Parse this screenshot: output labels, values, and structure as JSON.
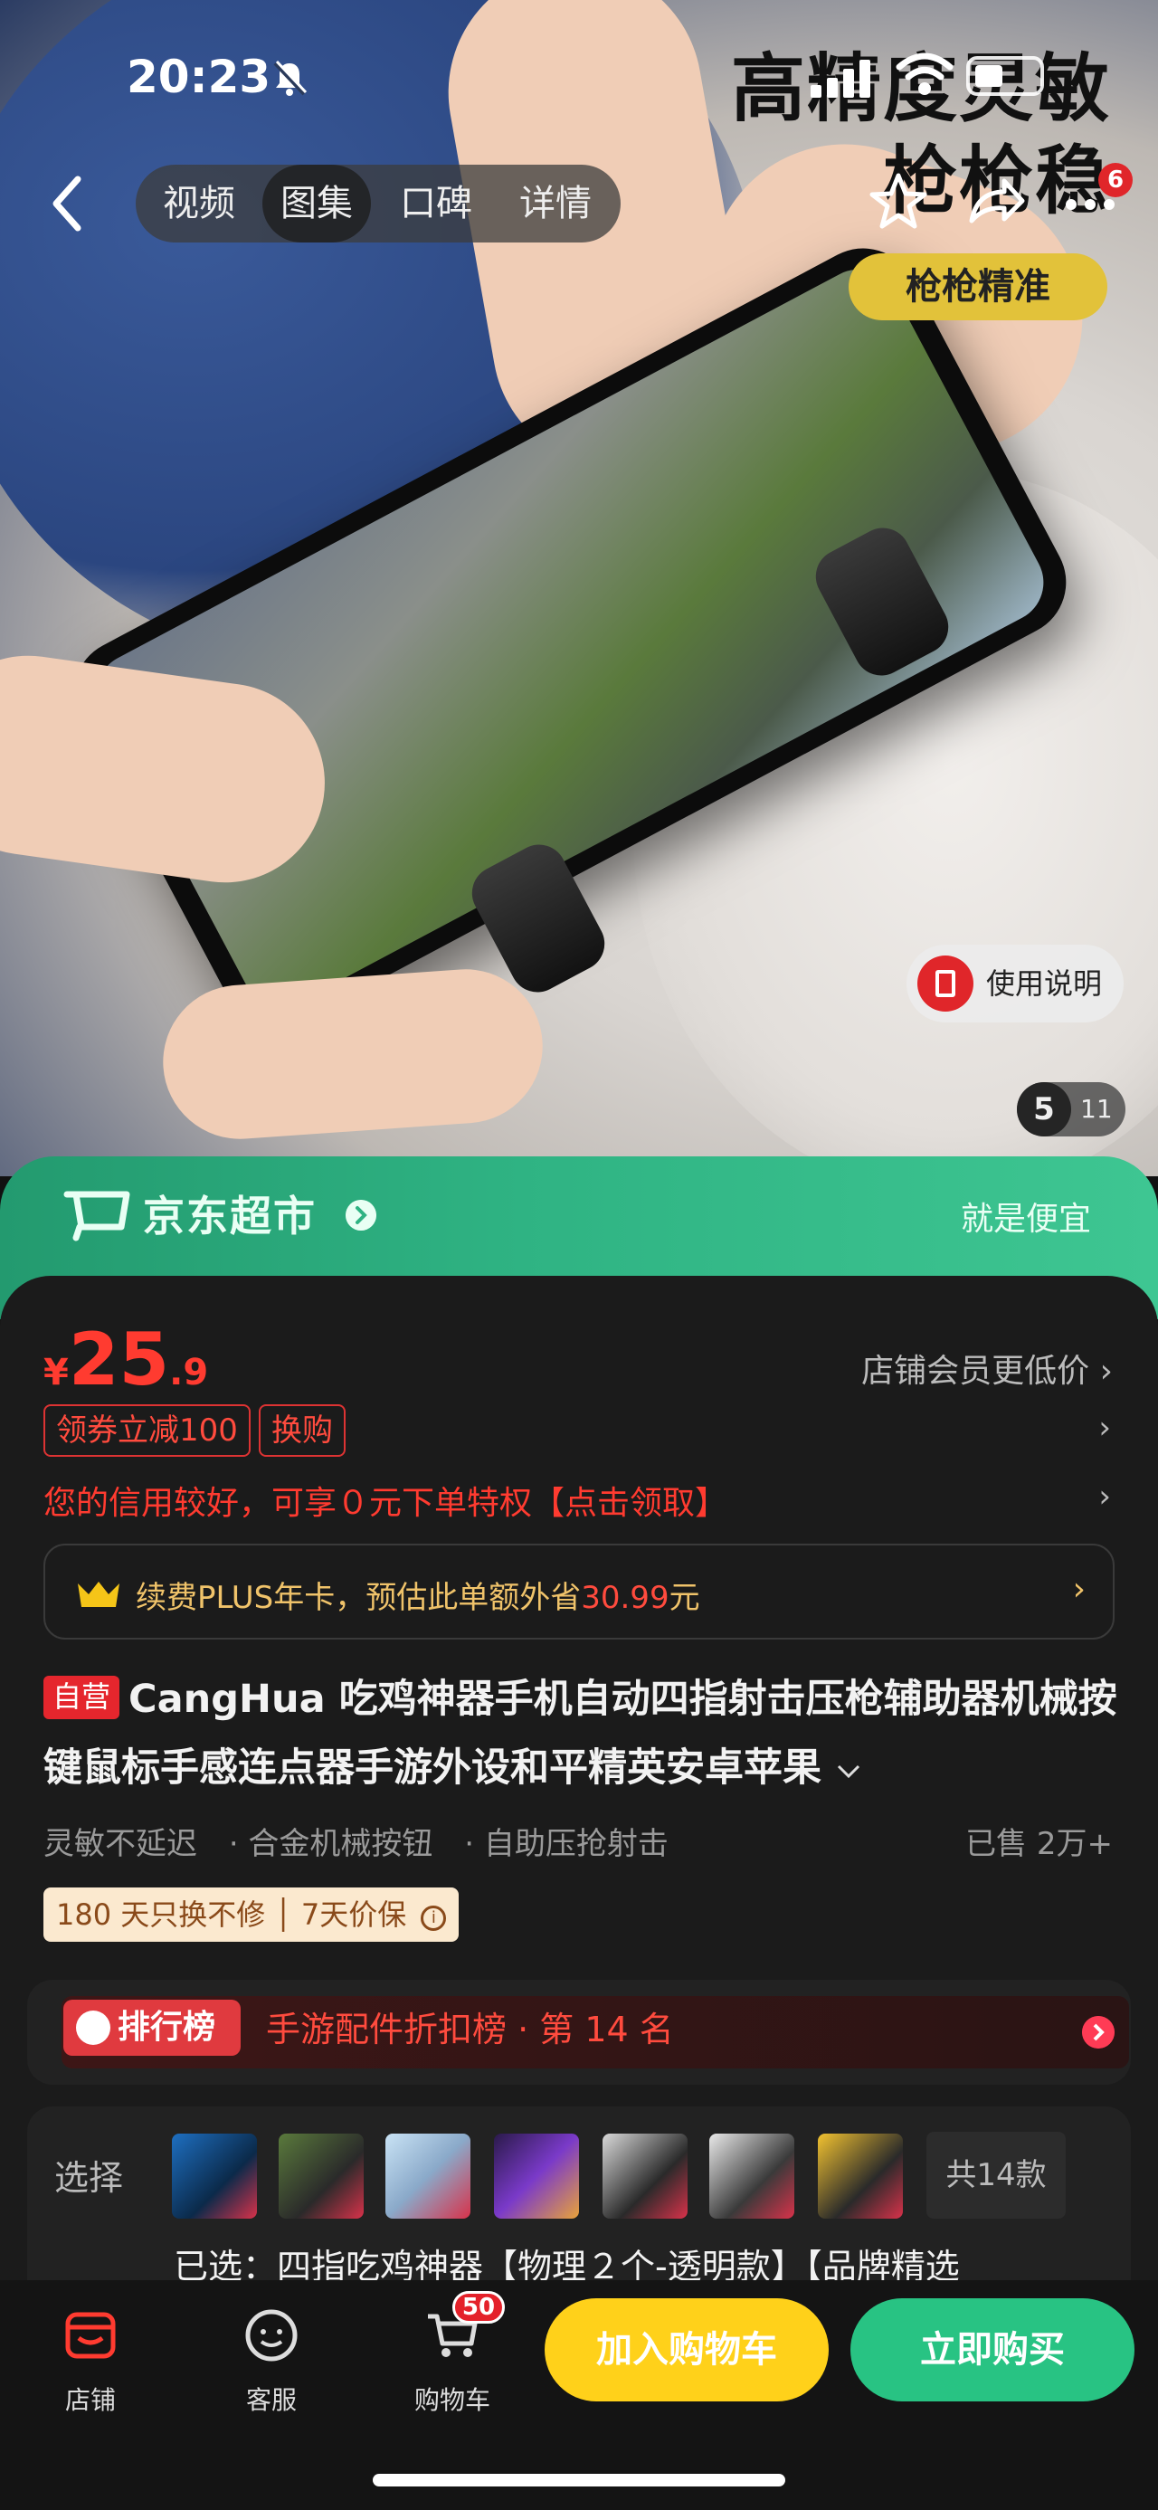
{
  "status_bar": {
    "time": "20:23"
  },
  "hero": {
    "headline_line1": "高精度灵敏",
    "headline_line2": "枪枪稳",
    "pill": "枪枪精准",
    "manual_label": "使用说明",
    "pager_current": "5",
    "pager_total": "11"
  },
  "nav": {
    "tabs": [
      {
        "label": "视频"
      },
      {
        "label": "图集"
      },
      {
        "label": "口碑"
      },
      {
        "label": "详情"
      }
    ],
    "active_tab": "图集",
    "more_badge": "6"
  },
  "banner": {
    "name": "京东超市",
    "slogan": "就是便宜"
  },
  "price": {
    "currency": "¥",
    "integer": "25",
    "decimal": ".9",
    "member_text": "店铺会员更低价"
  },
  "coupons": [
    {
      "label": "领券立减100"
    },
    {
      "label": "换购"
    }
  ],
  "credit_text": "您的信用较好，可享０元下单特权【点击领取】",
  "plus": {
    "text_prefix": "续费PLUS年卡，预估此单额外省",
    "amount": "30.99",
    "unit": "元"
  },
  "product": {
    "self_tag": "自营",
    "title": "CangHua 吃鸡神器手机自动四指射击压枪辅助器机械按键鼠标手感连点器手游外设和平精英安卓苹果",
    "features": [
      "灵敏不延迟",
      "· 合金机械按钮",
      "· 自助压抢射击"
    ],
    "sold": "已售 2万+",
    "service": "180 天只换不修 │ 7天价保"
  },
  "rank": {
    "label": "排行榜",
    "text": "手游配件折扣榜 · 第 14 名"
  },
  "selection": {
    "label": "选择",
    "total": "共14款",
    "chosen": "已选：四指吃鸡神器【物理２个-透明款】【品牌精选"
  },
  "bottom_bar": {
    "shop": "店铺",
    "service": "客服",
    "cart": "购物车",
    "cart_count": "50",
    "add_to_cart": "加入购物车",
    "buy_now": "立即购买"
  },
  "colors": {
    "price_red": "#ff3b30",
    "jd_green": "#2fb383",
    "add_cart_yellow": "#ffd11a",
    "buy_green": "#28c383"
  }
}
